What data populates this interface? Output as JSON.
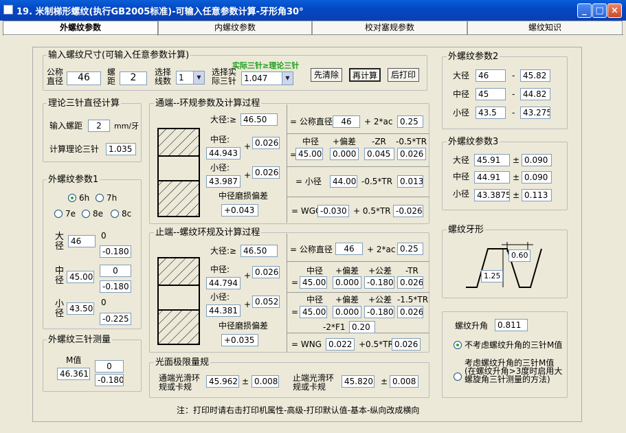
{
  "title": "19. 米制梯形螺纹(执行GB2005标准)-可输入任意参数计算-牙形角30°",
  "window_buttons": {
    "min": "_",
    "max": "□",
    "close": "×"
  },
  "tabs": [
    "外螺纹参数",
    "内螺纹参数",
    "校对塞规参数",
    "螺纹知识"
  ],
  "input_group": {
    "legend": "输入螺纹尺寸(可输入任意参数计算)",
    "nominal_label": "公称直径",
    "nominal": "46",
    "pitch_label": "螺距",
    "pitch": "2",
    "threads_label": "选择线数",
    "threads": "1",
    "pin_label": "选择实际三针",
    "pin": "1.047",
    "hint": "实际三针≥理论三针",
    "btn_clear": "先清除",
    "btn_calc": "再计算",
    "btn_print": "后打印"
  },
  "theory_pin": {
    "legend": "理论三针直径计算",
    "pitch_label": "输入螺距",
    "pitch": "2",
    "unit": "mm/牙",
    "result_label": "计算理论三针",
    "result": "1.035"
  },
  "params1": {
    "legend": "外螺纹参数1",
    "r6h": "6h",
    "r7h": "7h",
    "r7e": "7e",
    "r8e": "8e",
    "r8c": "8c",
    "major_label": "大径",
    "major": "46",
    "major_up": "0",
    "major_dn": "-0.180",
    "pitch_label": "中径",
    "pitch": "45.00",
    "pitch_up": "0",
    "pitch_dn": "-0.180",
    "minor_label": "小径",
    "minor": "43.50",
    "minor_up": "0",
    "minor_dn": "-0.225"
  },
  "pinmeasure": {
    "legend": "外螺纹三针测量",
    "m_label": "M值",
    "m": "46.361",
    "m_up": "0",
    "m_dn": "-0.180"
  },
  "go": {
    "legend": "通端--环规参数及计算过程",
    "major_label": "大径:≥",
    "major": "46.50",
    "pitch_label": "中径:",
    "pitch": "44.943",
    "pitch_plus": "0.026",
    "minor_label": "小径:",
    "minor": "43.987",
    "minor_plus": "0.026",
    "wear_label": "中径磨损偏差",
    "wear": "+0.043",
    "eq1": "= 公称直径",
    "eq1v": "46",
    "eq1p": "+ 2*ac",
    "eq1r": "0.25",
    "h1": "中径",
    "h2": "+偏差",
    "h3": "-ZR",
    "h4": "-0.5*TR",
    "r1": "45.00",
    "r2": "0.000",
    "r3": "0.045",
    "r4": "0.026",
    "eq3": "= 小径",
    "eq3v": "44.00",
    "eq3p": "-0.5*TR",
    "eq3r": "0.013",
    "eq4": "= WGO",
    "eq4v": "-0.030",
    "eq4p": "+ 0.5*TR",
    "eq4r": "-0.026"
  },
  "nogo": {
    "legend": "止端--螺纹环规及计算过程",
    "major_label": "大径:≥",
    "major": "46.50",
    "pitch_label": "中径:",
    "pitch": "44.794",
    "pitch_plus": "0.026",
    "minor_label": "小径:",
    "minor": "44.381",
    "minor_plus": "0.052",
    "wear_label": "中径磨损偏差",
    "wear": "+0.035",
    "eq1": "= 公称直径",
    "eq1v": "46",
    "eq1p": "+ 2*ac",
    "eq1r": "0.25",
    "ah1": "中径",
    "ah2": "+偏差",
    "ah3": "+公差",
    "ah4": "-TR",
    "ar1": "45.00",
    "ar2": "0.000",
    "ar3": "-0.180",
    "ar4": "0.026",
    "bh1": "中径",
    "bh2": "+偏差",
    "bh3": "+公差",
    "bh4": "-1.5*TR",
    "br1": "45.00",
    "br2": "0.000",
    "br3": "-0.180",
    "br4": "0.026",
    "bf": "-2*F1",
    "bfv": "0.20",
    "eq4": "= WNG",
    "eq4v": "0.022",
    "eq4p": "+0.5*TR",
    "eq4r": "0.026"
  },
  "smooth": {
    "legend": "光面极限量规",
    "go_label": "通端光滑环规或卡规",
    "go": "45.962",
    "go_pm": "±",
    "go_tol": "0.008",
    "nogo_label": "止端光滑环规或卡规",
    "nogo": "45.820",
    "nogo_pm": "±",
    "nogo_tol": "0.008"
  },
  "params2": {
    "legend": "外螺纹参数2",
    "major_label": "大径",
    "major_a": "46",
    "major_b": "45.82",
    "pitch_label": "中径",
    "pitch_a": "45",
    "pitch_b": "44.82",
    "minor_label": "小径",
    "minor_a": "43.5",
    "minor_b": "43.275",
    "dash": "-"
  },
  "params3": {
    "legend": "外螺纹参数3",
    "major_label": "大径",
    "major": "45.91",
    "major_tol": "0.090",
    "pitch_label": "中径",
    "pitch": "44.91",
    "pitch_tol": "0.090",
    "minor_label": "小径",
    "minor": "43.3875",
    "minor_tol": "0.113",
    "pm": "±"
  },
  "profile": {
    "legend": "螺纹牙形",
    "top": "0.60",
    "depth": "1.25"
  },
  "lead": {
    "label": "螺纹升角",
    "value": "0.811",
    "opt1": "不考虑螺纹升角的三针M值",
    "opt2": "考虑螺纹升角的三针M值(在螺纹升角>3度时启用大螺旋角三针测量的方法)"
  },
  "note": "注：打印时请右击打印机属性-高级-打印默认值-基本-纵向改成横向"
}
